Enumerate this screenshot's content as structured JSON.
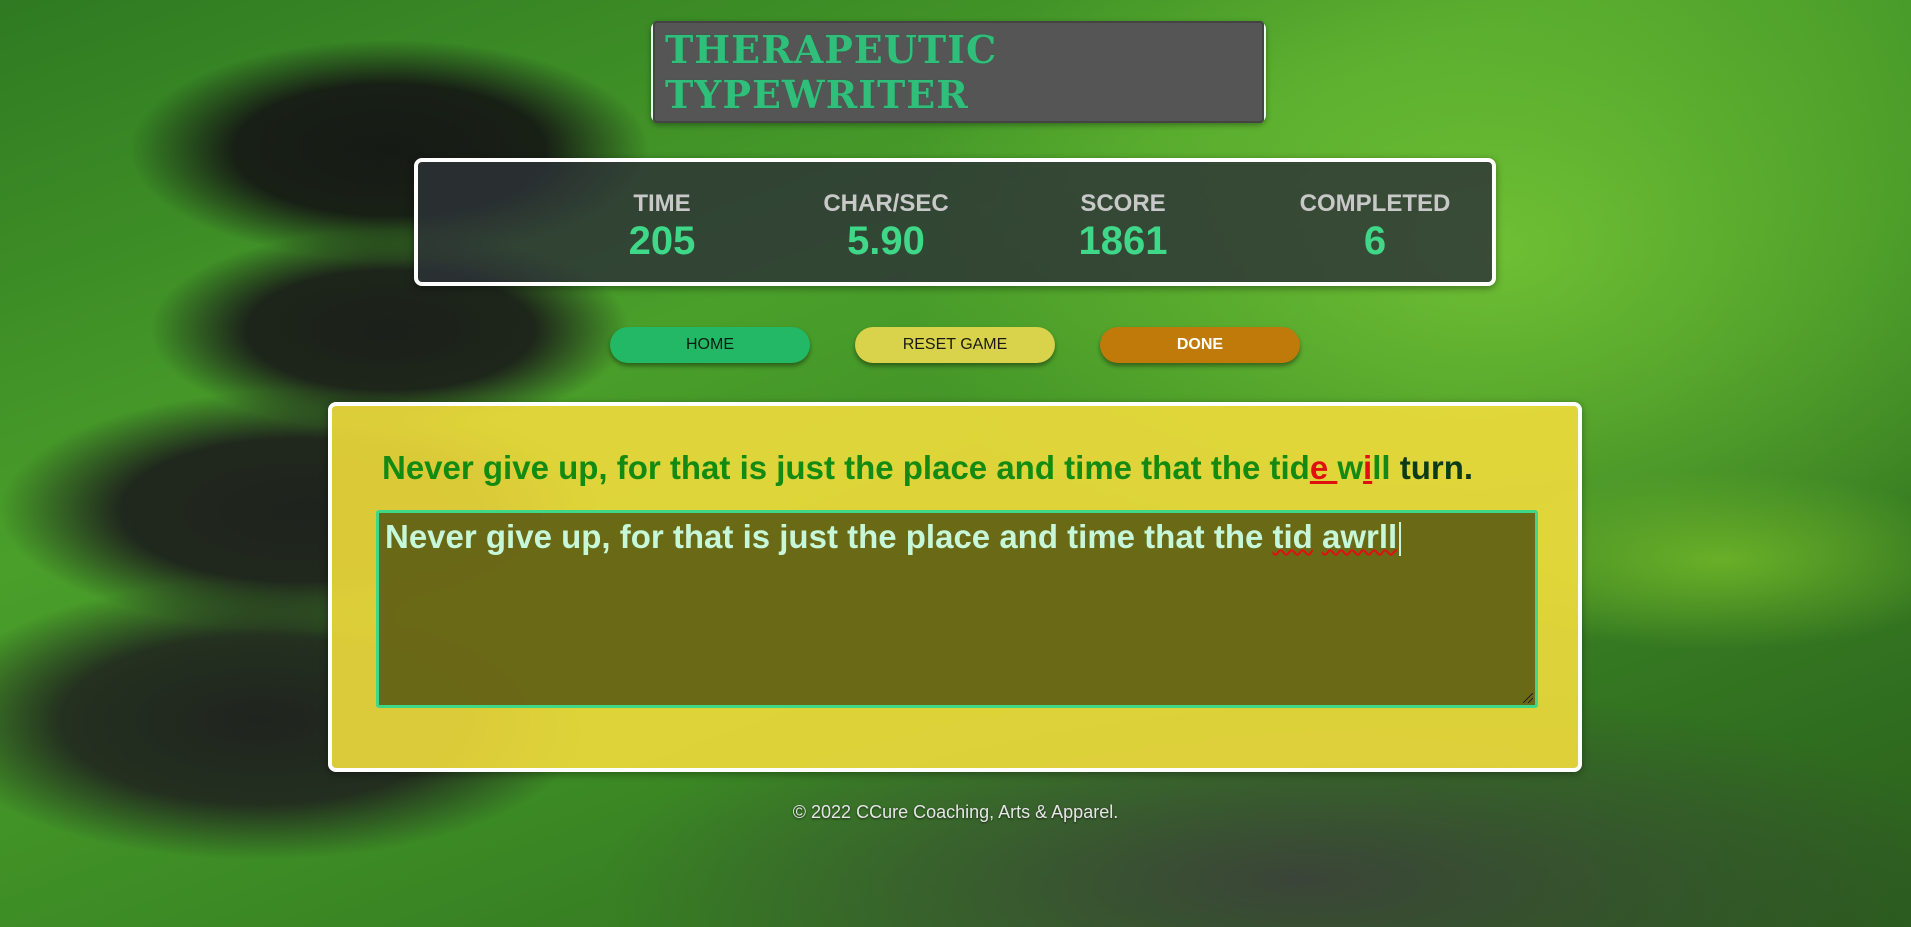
{
  "header": {
    "title": "THERAPEUTIC TYPEWRITER"
  },
  "stats": {
    "time": {
      "label": "TIME",
      "value": "205"
    },
    "chars_per_sec": {
      "label": "CHAR/SEC",
      "value": "5.90"
    },
    "score": {
      "label": "SCORE",
      "value": "1861"
    },
    "completed": {
      "label": "COMPLETED",
      "value": "6"
    }
  },
  "buttons": {
    "home": "HOME",
    "reset": "RESET GAME",
    "done": "DONE"
  },
  "game": {
    "target_segments": [
      {
        "text": "Never give up, for that is just the place and time that the tid",
        "state": "correct"
      },
      {
        "text": "e ",
        "state": "error"
      },
      {
        "text": "w",
        "state": "correct"
      },
      {
        "text": "i",
        "state": "error"
      },
      {
        "text": "ll",
        "state": "correct"
      },
      {
        "text": " turn.",
        "state": "pending"
      }
    ],
    "typed_text": {
      "plain": "Never give up, for that is just the place and time that the ",
      "misspelled_1": "tid",
      "space": " ",
      "misspelled_2": "awrll"
    }
  },
  "footer": {
    "text": "© 2022 CCure Coaching, Arts & Apparel."
  },
  "colors": {
    "accent_green": "#3fd888",
    "correct": "#138a12",
    "error": "#e01010",
    "pending": "#0d3a18",
    "game_panel": "#f0dc3c",
    "done_button": "#c07a0a",
    "reset_button": "#d8d34a",
    "home_button": "#22b866"
  }
}
